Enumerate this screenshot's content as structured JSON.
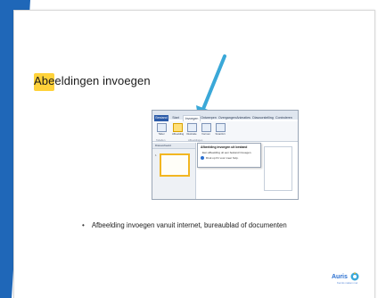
{
  "slide": {
    "title": "Abeeldingen invoegen",
    "bullet": "Afbeelding invoegen vanuit internet, bureaublad of documenten"
  },
  "screenshot": {
    "tabs": [
      "Bestand",
      "Start",
      "Invoegen",
      "Ontwerpen",
      "Overgangen",
      "Animaties",
      "Diavoorstelling",
      "Controleren",
      "Beeld"
    ],
    "ribbon_buttons": [
      "Tabel",
      "Afbeelding",
      "Illustratie",
      "Vormen",
      "SmartArt"
    ],
    "groups": [
      "Tabellen",
      "Afbeeldingen"
    ],
    "panel_header": "Diavoorbeeld",
    "slide_number": "1",
    "tooltip": {
      "title": "Afbeelding invoegen uit bestand",
      "description": "Een afbeelding uit een bestand invoegen.",
      "help": "Druk op F1 voor meer hulp."
    }
  },
  "logo": {
    "word": "Auris",
    "tagline": "Kennis maken met"
  },
  "colors": {
    "highlight": "#ffd23a",
    "arrow": "#3aa8d8",
    "edge": "#1f67b8"
  }
}
